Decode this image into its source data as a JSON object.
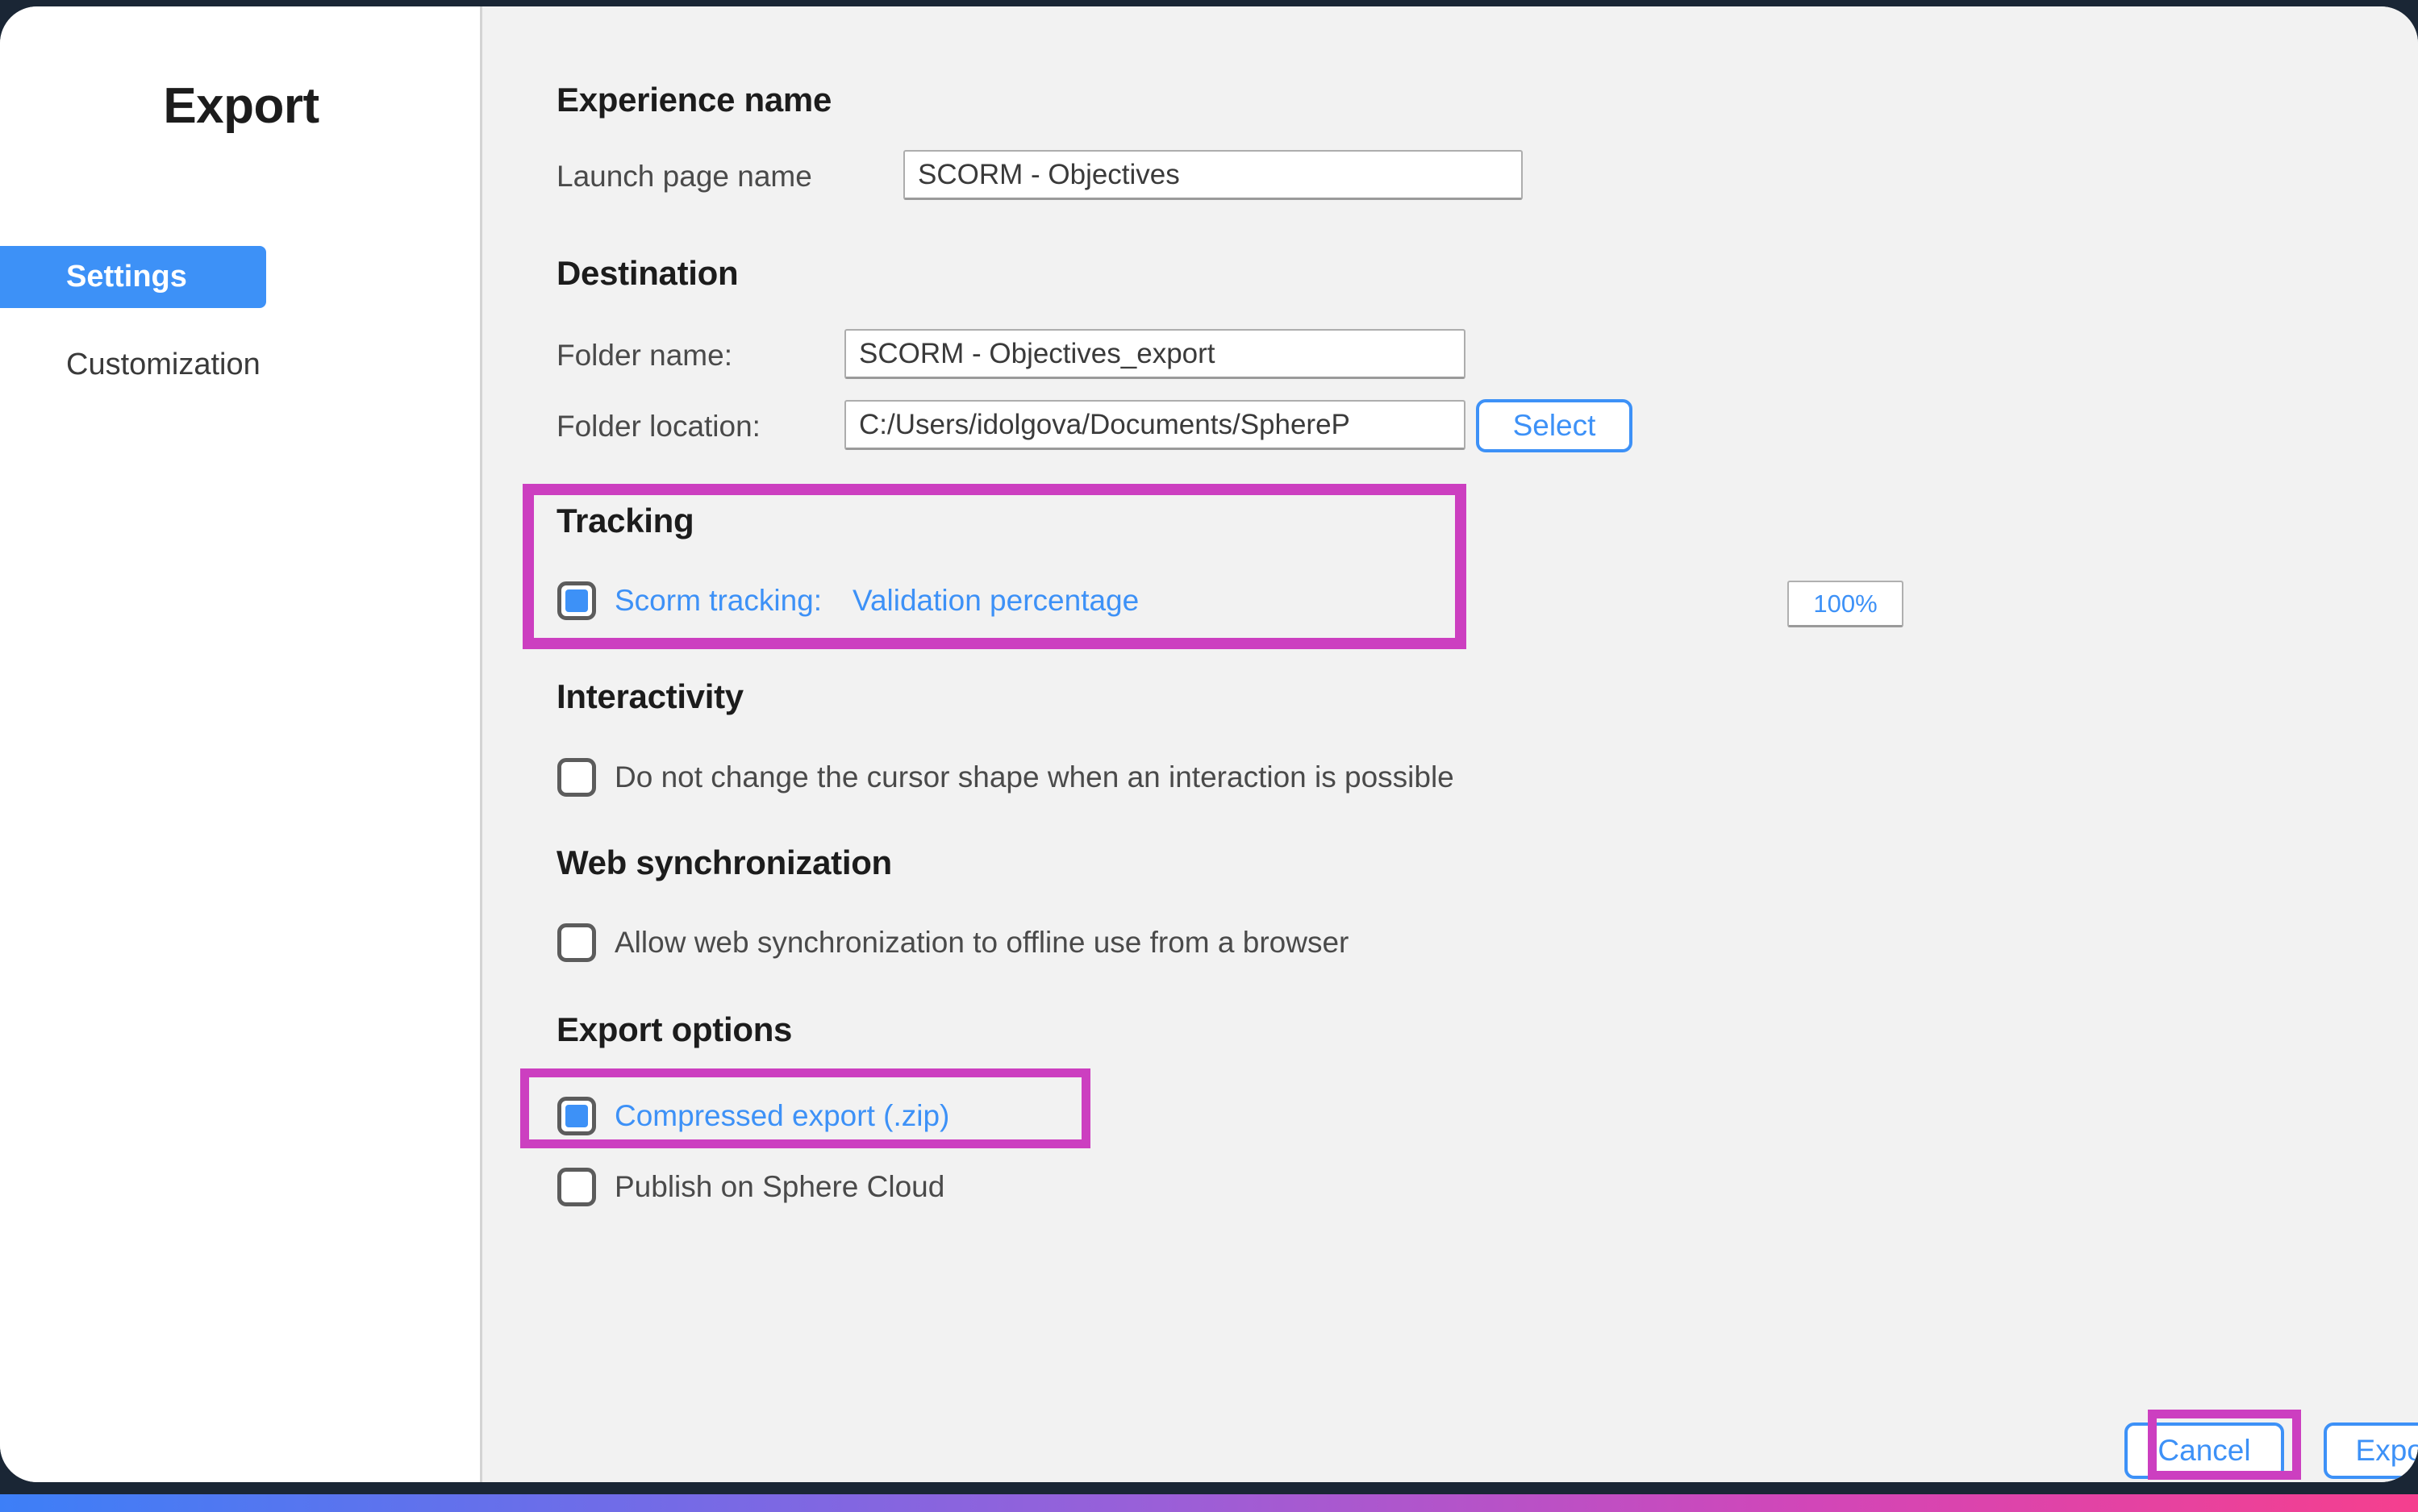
{
  "dialog": {
    "title": "Export"
  },
  "sidebar": {
    "items": [
      {
        "label": "Settings",
        "active": true
      },
      {
        "label": "Customization",
        "active": false
      }
    ]
  },
  "sections": {
    "experience_name": {
      "heading": "Experience name",
      "launch_page_label": "Launch page name",
      "launch_page_value": "SCORM - Objectives",
      "launch_page_placeholder": "Launch page name"
    },
    "destination": {
      "heading": "Destination",
      "folder_name_label": "Folder name:",
      "folder_name_value": "SCORM - Objectives_export",
      "folder_name_placeholder": "Folder name",
      "folder_location_label": "Folder location:",
      "folder_location_value": "C:/Users/idolgova/Documents/SphereP",
      "folder_location_placeholder": "Folder location",
      "select_button": "Select"
    },
    "tracking": {
      "heading": "Tracking",
      "scorm_tracking_label": "Scorm tracking:",
      "validation_percentage_label": "Validation percentage",
      "validation_percentage_value": "100%",
      "scorm_tracking_checked": true
    },
    "interactivity": {
      "heading": "Interactivity",
      "cursor_option_label": "Do not change the cursor shape when an interaction is possible",
      "cursor_option_checked": false
    },
    "web_synchronization": {
      "heading": "Web synchronization",
      "offline_option_label": "Allow web synchronization to offline use from a browser",
      "offline_option_checked": false
    },
    "export_options": {
      "heading": "Export options",
      "compressed_label": "Compressed export (.zip)",
      "compressed_checked": true,
      "publish_label": "Publish on Sphere Cloud",
      "publish_checked": false
    }
  },
  "footer": {
    "cancel_button": "Cancel",
    "export_button": "Export"
  },
  "colors": {
    "accent_blue": "#3d91f7",
    "highlight_magenta": "#cc3fc0",
    "backdrop_navy": "#1a2635",
    "panel_gray": "#f2f2f2"
  }
}
